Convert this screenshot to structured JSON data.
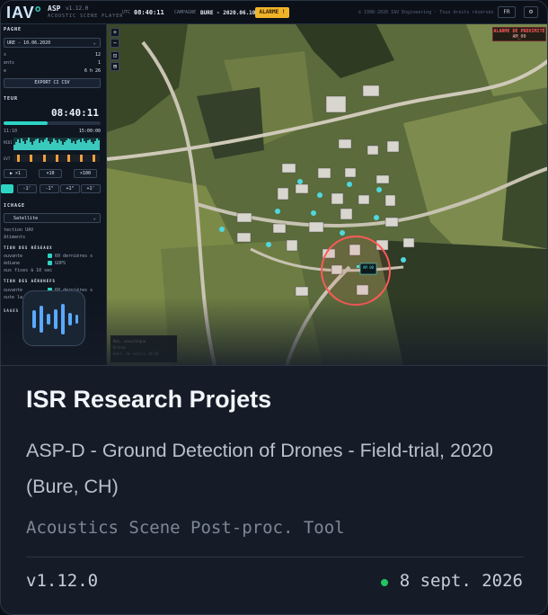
{
  "card": {
    "title": "ISR Research Projets",
    "subtitle": "ASP-D - Ground Detection of Drones - Field-trial, 2020 (Bure, CH)",
    "tagline": "Acoustics Scene Post-proc. Tool",
    "version": "v1.12.0",
    "date": "8 sept. 2026",
    "status_color": "#22c55e",
    "app_icon": "waveform-icon"
  },
  "preview": {
    "topbar": {
      "logo": "IAV",
      "app_name": "ASP",
      "app_version": "v1.12.0",
      "app_subtitle": "ACOUSTIC SCENE PLAYER",
      "utc_label": "UTC",
      "utc_value": "08:40:11",
      "campaign_label": "CAMPAGNE",
      "campaign_value": "BURE - 2020.06.10",
      "alarm_badge": "ALARME !",
      "copyright": "© 1998-2026 IAV Engineering · Tous droits réservés",
      "language": "FR",
      "settings_icon": "gear-icon"
    },
    "sidebar": {
      "campaign_header": "PAGNE",
      "campaign_select": "URE - 10.06.2020",
      "stats": [
        {
          "label": "s",
          "value": "12"
        },
        {
          "label": "ents",
          "value": "1"
        },
        {
          "label": "e",
          "value": "6 h 26"
        }
      ],
      "export_button": "EXPORT CI CSV",
      "player_header": "TEUR",
      "clock": "08:40:11",
      "scrub_progress": 0.45,
      "time_start": "11:10",
      "time_end": "15:00:00",
      "track_labels": [
        "MIDI",
        "EVT"
      ],
      "speed_buttons": [
        "▶ ×1",
        "×10",
        "×100"
      ],
      "step_buttons": [
        "",
        "-1'",
        "-1\"",
        "+1\"",
        "+1'"
      ],
      "display_header": "ICHAGE",
      "basemap_select": "Satellite",
      "layers": [
        "tection UAV",
        "âtiments"
      ],
      "sensors_header": "TION DES RÉSEAUX",
      "sensors": [
        {
          "label": "ouvante",
          "option": "60 dernières s"
        },
        {
          "label": "édiane",
          "option": "GOPS"
        },
        {
          "label": "ous fixes à 10 sec",
          "option": ""
        }
      ],
      "aircraft_header": "TION DES AÉRONEFS",
      "aircraft": [
        {
          "label": "ouvante",
          "option": "60 dernières s"
        },
        {
          "label": "oute la",
          "option": ""
        }
      ],
      "bottom_header": "SAGES"
    },
    "map": {
      "controls": [
        "+",
        "−",
        "⊡",
        "⊞"
      ],
      "alarm_panel_title": "ALARME DE PROXIMITÉ",
      "alarm_panel_value": "AM_00",
      "target_label": "AM 00",
      "legend": [
        "Rés. acoustique",
        "Drones",
        "Emet. de source 2D/3D"
      ]
    }
  }
}
